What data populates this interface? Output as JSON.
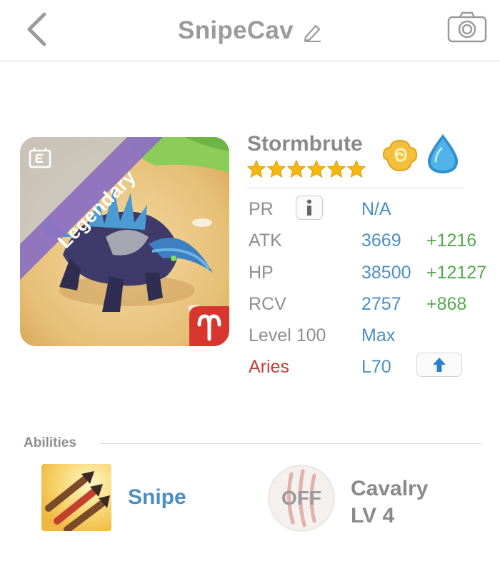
{
  "header": {
    "title": "SnipeCav",
    "back_icon": "chevron-left-icon",
    "edit_icon": "pencil-icon",
    "camera_icon": "camera-icon"
  },
  "monster": {
    "rarity": "Legendary",
    "name": "Stormbrute",
    "stars": 6,
    "elements": [
      "light-element-icon",
      "water-element-icon"
    ],
    "zodiac_icon": "aries-icon"
  },
  "stats": [
    {
      "label": "PR",
      "value": "N/A",
      "bonus": ""
    },
    {
      "label": "ATK",
      "value": "3669",
      "bonus": "+1216"
    },
    {
      "label": "HP",
      "value": "38500",
      "bonus": "+12127"
    },
    {
      "label": "RCV",
      "value": "2757",
      "bonus": "+868"
    },
    {
      "label": "Level 100",
      "value": "Max",
      "bonus": ""
    },
    {
      "label": "Aries",
      "value": "L70",
      "bonus": ""
    }
  ],
  "abilities": {
    "section_label": "Abilities",
    "items": [
      {
        "name": "Snipe",
        "icon": "snipe-arrows-icon"
      },
      {
        "name": "Cavalry",
        "level": "LV 4",
        "badge": "OFF",
        "icon": "cavalry-claw-icon"
      }
    ]
  },
  "colors": {
    "accent_blue": "#4a8ec4",
    "bonus_green": "#55a84d",
    "zodiac_red": "#c43c34",
    "rarity_purple": "#8c72c2",
    "star_gold": "#f5b80f"
  }
}
